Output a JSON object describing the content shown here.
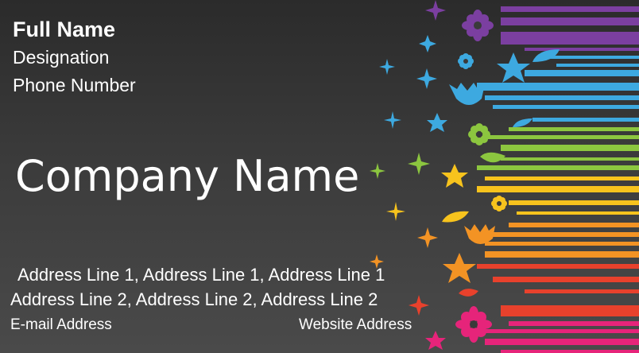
{
  "card": {
    "full_name": "Full Name",
    "designation": "Designation",
    "phone": "Phone Number",
    "company": "Company Name",
    "address_line_1": "Address Line 1,  Address Line 1,  Address Line 1",
    "address_line_2": "Address Line 2,  Address Line 2,  Address Line 2",
    "email": "E-mail Address",
    "website": "Website Address"
  },
  "theme": {
    "background": "#333333",
    "text": "#ffffff",
    "rainbow": [
      "#7b3fa0",
      "#3da9e0",
      "#8cc63f",
      "#f7c31d",
      "#f39324",
      "#e8412c",
      "#e6247a"
    ]
  },
  "decorations": {
    "icons": [
      "flower-icon",
      "star-icon",
      "sparkle-icon",
      "leaf-icon",
      "tulip-icon"
    ]
  }
}
